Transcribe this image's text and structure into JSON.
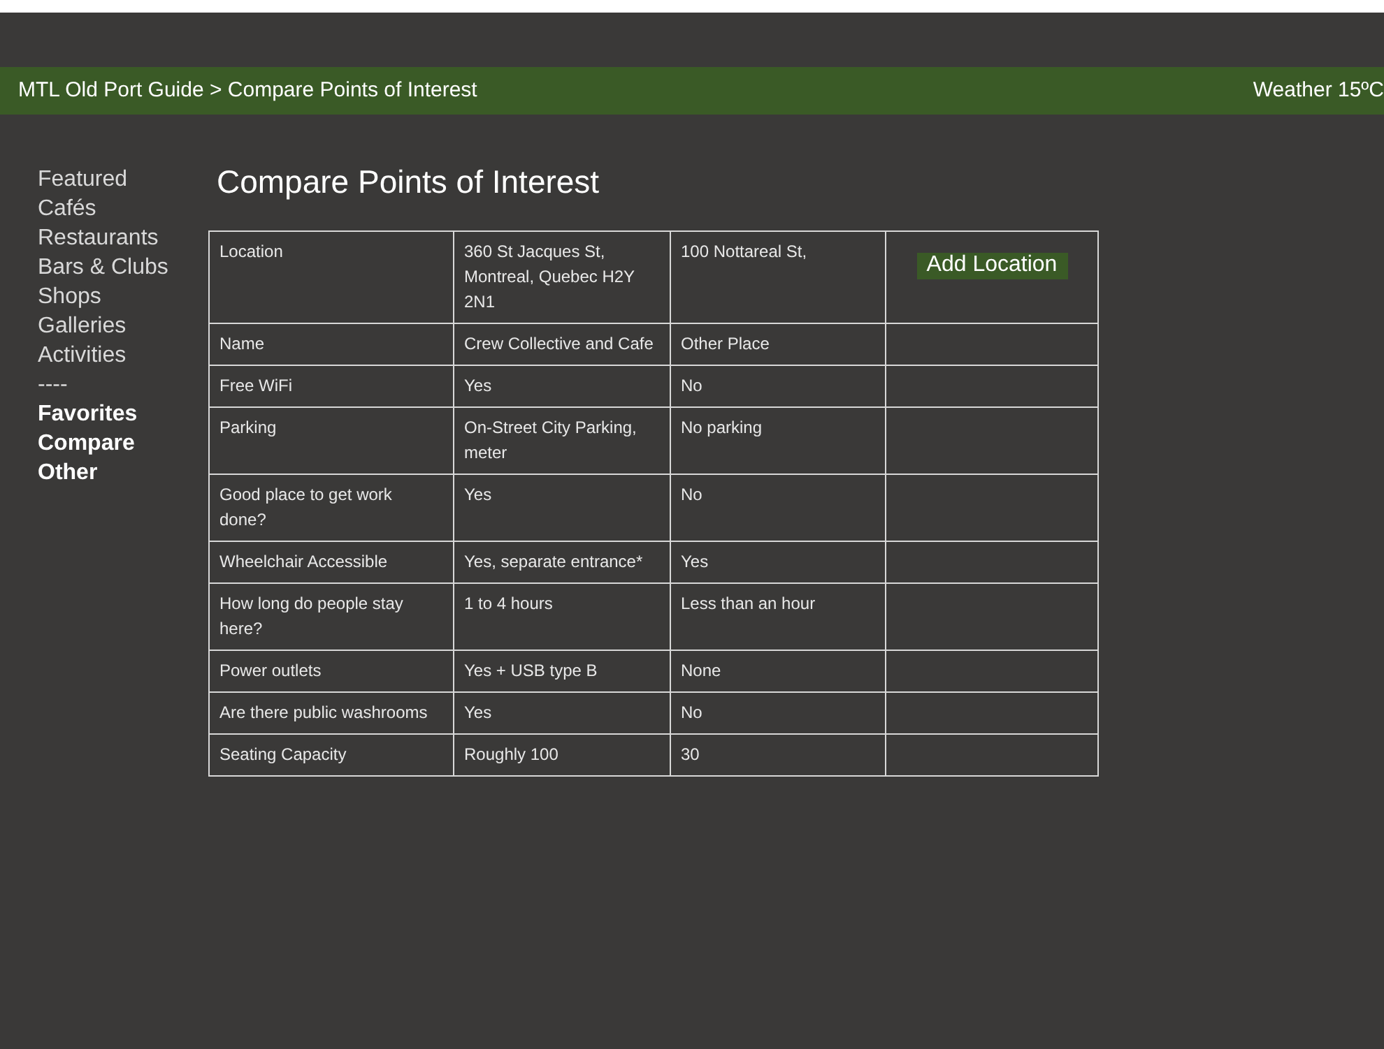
{
  "header": {
    "breadcrumb": "MTL Old Port Guide > Compare Points of Interest",
    "weather": "Weather 15ºC"
  },
  "sidebar": {
    "items": [
      {
        "label": "Featured",
        "emphasized": false
      },
      {
        "label": "Cafés",
        "emphasized": false
      },
      {
        "label": "Restaurants",
        "emphasized": false
      },
      {
        "label": "Bars & Clubs",
        "emphasized": false
      },
      {
        "label": "Shops",
        "emphasized": false
      },
      {
        "label": "Galleries",
        "emphasized": false
      },
      {
        "label": "Activities",
        "emphasized": false
      },
      {
        "label": "----",
        "emphasized": false
      },
      {
        "label": "Favorites",
        "emphasized": true
      },
      {
        "label": "Compare",
        "emphasized": true
      },
      {
        "label": "Other",
        "emphasized": true
      }
    ]
  },
  "page_title": "Compare Points of Interest",
  "table": {
    "add_button": "Add Location",
    "rows": [
      {
        "label": "Location",
        "values": [
          "360 St Jacques St, Montreal, Quebec H2Y 2N1",
          "100 Nottareal St,"
        ]
      },
      {
        "label": "Name",
        "values": [
          "Crew Collective and Cafe",
          "Other Place"
        ]
      },
      {
        "label": "Free WiFi",
        "values": [
          "Yes",
          "No"
        ]
      },
      {
        "label": "Parking",
        "values": [
          "On-Street City Parking, meter",
          "No parking"
        ]
      },
      {
        "label": "Good place to get work done?",
        "values": [
          "Yes",
          "No"
        ]
      },
      {
        "label": "Wheelchair Accessible",
        "values": [
          "Yes, separate entrance*",
          "Yes"
        ]
      },
      {
        "label": "How long do people stay here?",
        "values": [
          "1 to 4 hours",
          "Less than an hour"
        ]
      },
      {
        "label": "Power outlets",
        "values": [
          "Yes + USB type B",
          "None"
        ]
      },
      {
        "label": "Are there public washrooms",
        "values": [
          "Yes",
          "No"
        ]
      },
      {
        "label": "Seating Capacity",
        "values": [
          "Roughly 100",
          "30"
        ]
      }
    ]
  }
}
